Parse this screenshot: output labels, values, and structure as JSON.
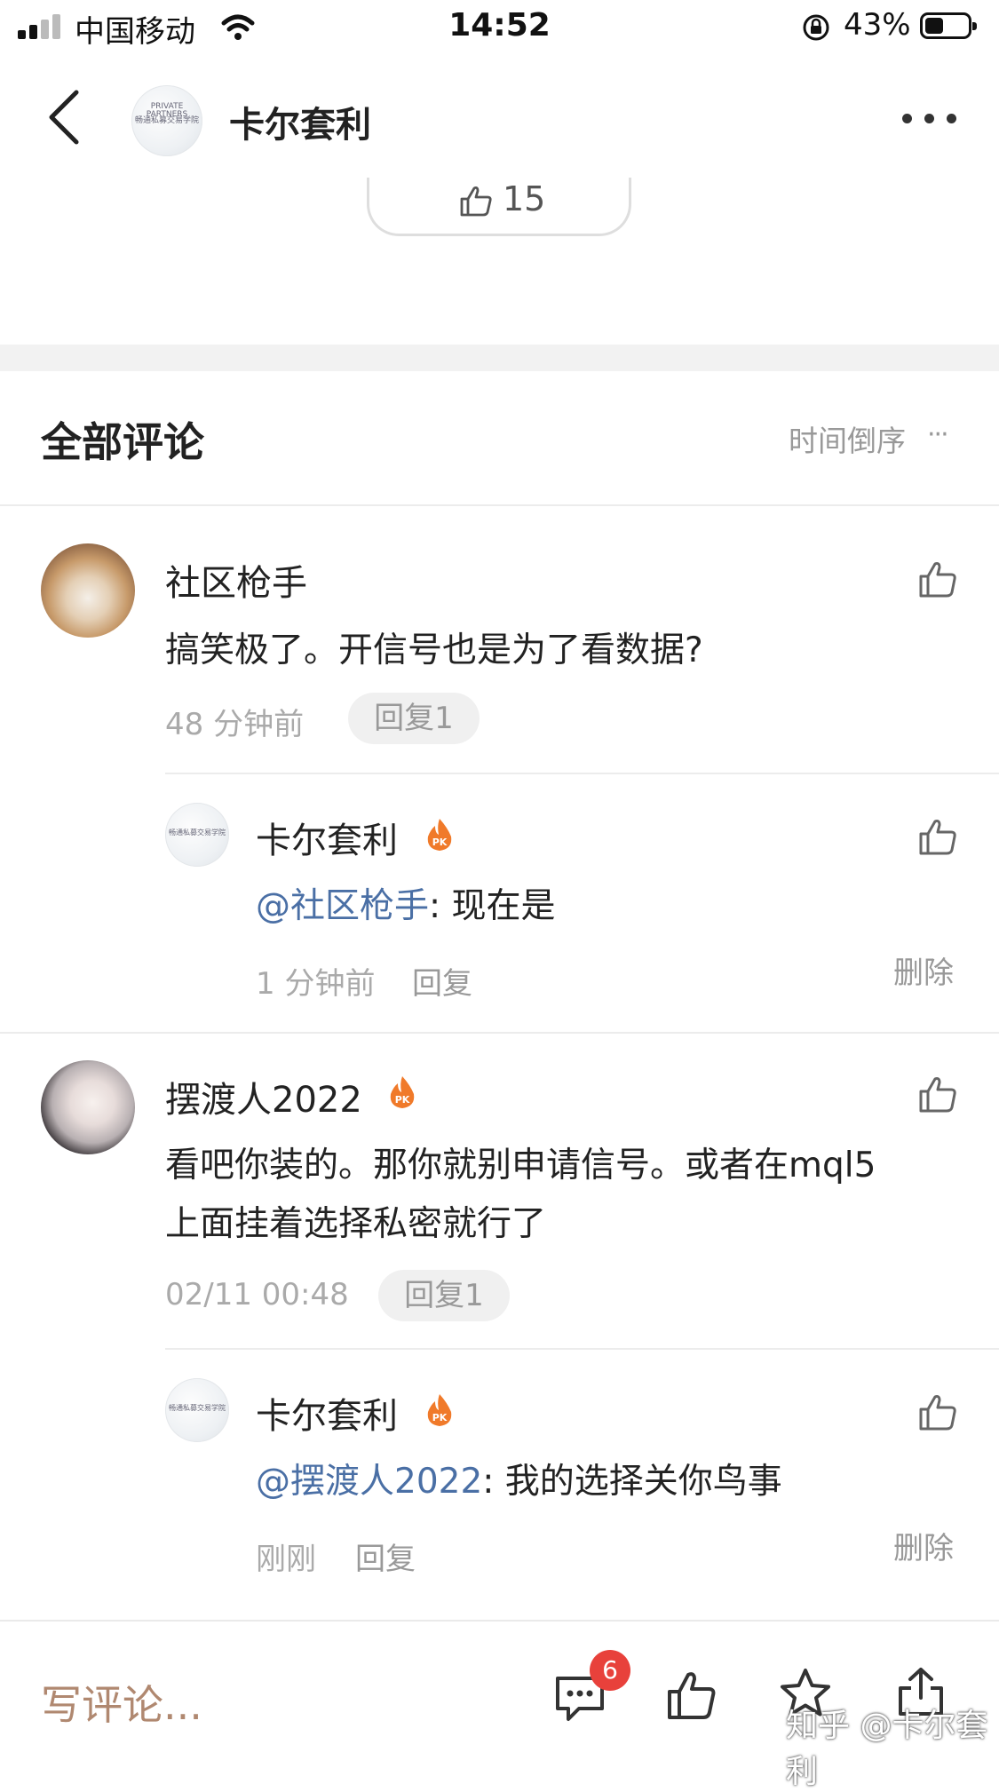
{
  "status_bar": {
    "carrier": "中国移动",
    "time": "14:52",
    "battery_percent": "43%",
    "battery_level": 0.43
  },
  "header": {
    "title": "卡尔套利",
    "avatar_caption_top": "PRIVATE PARTNERS",
    "avatar_caption": "畅通私募交易学院",
    "icons": [
      "back-chevron-icon",
      "more-dots-icon"
    ]
  },
  "post_actions": {
    "like_count": "15"
  },
  "comments_section": {
    "title": "全部评论",
    "sort_label": "时间倒序",
    "sort_more": "···"
  },
  "comments": [
    {
      "author": "社区枪手",
      "text": "搞笑极了。开信号也是为了看数据?",
      "time": "48 分钟前",
      "reply_chip": "回复1",
      "replies": [
        {
          "author": "卡尔套利",
          "badge": "PK",
          "mention": "@社区枪手",
          "text": ": 现在是",
          "time": "1 分钟前",
          "reply_label": "回复",
          "delete_label": "删除"
        }
      ]
    },
    {
      "author": "摆渡人2022",
      "badge": "PK",
      "text_line1": "看吧你装的。那你就别申请信号。或者在mql5",
      "text_line2": "上面挂着选择私密就行了",
      "time": "02/11 00:48",
      "reply_chip": "回复1",
      "replies": [
        {
          "author": "卡尔套利",
          "badge": "PK",
          "mention": "@摆渡人2022",
          "text": ": 我的选择关你鸟事",
          "time": "刚刚",
          "reply_label": "回复",
          "delete_label": "删除"
        }
      ]
    }
  ],
  "bottom_bar": {
    "write_placeholder": "写评论...",
    "comment_count_badge": "6",
    "watermark": "知乎 @卡尔套利"
  },
  "colors": {
    "mention": "#4a6fa5",
    "badge_red": "#e8413b",
    "pk_orange": "#f07a2a",
    "write_comment": "#b08870",
    "section_gap": "#f2f2f2"
  }
}
